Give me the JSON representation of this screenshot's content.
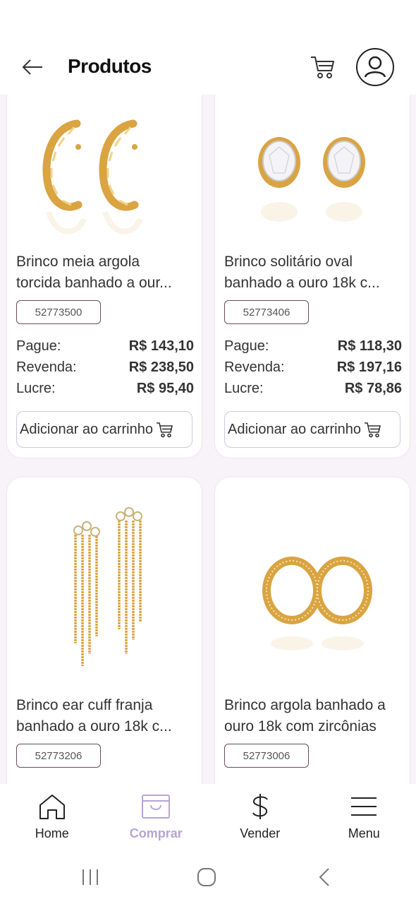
{
  "header": {
    "title": "Produtos"
  },
  "products": [
    {
      "name_line1": "Brinco meia argola",
      "name_line2": "torcida banhado a our...",
      "code": "52773500",
      "pay_label": "Pague:",
      "pay_value": "R$ 143,10",
      "resale_label": "Revenda:",
      "resale_value": "R$ 238,50",
      "profit_label": "Lucre:",
      "profit_value": "R$ 95,40",
      "add_label": "Adicionar ao carrinho",
      "image_icon": "twisted-hoop-earrings"
    },
    {
      "name_line1": "Brinco solitário oval",
      "name_line2": "banhado a ouro 18k c...",
      "code": "52773406",
      "pay_label": "Pague:",
      "pay_value": "R$ 118,30",
      "resale_label": "Revenda:",
      "resale_value": "R$ 197,16",
      "profit_label": "Lucre:",
      "profit_value": "R$ 78,86",
      "add_label": "Adicionar ao carrinho",
      "image_icon": "oval-stud-earrings"
    },
    {
      "name_line1": "Brinco ear cuff franja",
      "name_line2": "banhado a ouro 18k c...",
      "code": "52773206",
      "image_icon": "fringe-ear-cuff-earrings"
    },
    {
      "name_line1": "Brinco argola banhado a",
      "name_line2": "ouro 18k com zircônias",
      "code": "52773006",
      "image_icon": "zirconia-hoop-earrings"
    }
  ],
  "bottom_nav": {
    "home": "Home",
    "shop": "Comprar",
    "sell": "Vender",
    "menu": "Menu"
  },
  "colors": {
    "accent": "#b7a4d6",
    "gold": "#d9a441",
    "code_border": "#6b4b5e",
    "content_bg": "#f7f3f8"
  }
}
